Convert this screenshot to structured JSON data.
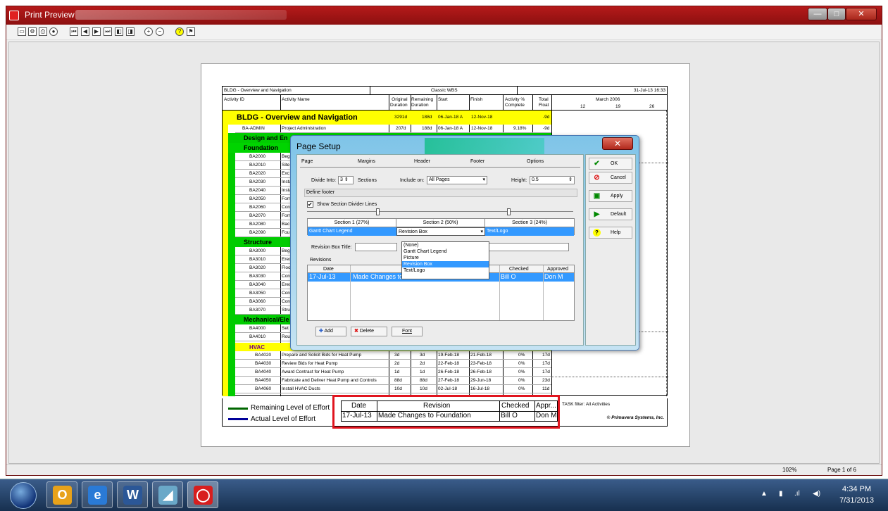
{
  "window": {
    "title": "Print Preview",
    "min": "—",
    "max": "□",
    "close": "✕"
  },
  "toolbar": {
    "icons": [
      "page-setup-icon",
      "print-options-icon",
      "print-icon",
      "publish-icon",
      "first-page-icon",
      "prev-page-icon",
      "next-page-icon",
      "last-page-icon",
      "first-icon",
      "last-icon",
      "zoom-in-icon",
      "zoom-out-icon",
      "help-icon",
      "settings-icon"
    ]
  },
  "report": {
    "header_left": "BLDG - Overview and Navigation",
    "header_center": "Classic WBS",
    "header_right": "31-Jul-13 16:33",
    "cols": {
      "id": "Activity ID",
      "name": "Activity Name",
      "orig1": "Original",
      "orig2": "Duration",
      "rem1": "Remaining",
      "rem2": "Duration",
      "start": "Start",
      "finish": "Finish",
      "pct1": "Activity %",
      "pct2": "Complete",
      "float1": "Total",
      "float2": "Float",
      "month": "March 2006",
      "w1": "12",
      "w2": "19",
      "w3": "26"
    },
    "project": {
      "name": "BLDG - Overview and Navigation",
      "orig": "3291d",
      "rem": "188d",
      "start": "06-Jan-18 A",
      "finish": "12-Nov-18",
      "float": "-9d"
    },
    "admin": {
      "id": "BA-ADMIN",
      "name": "Project Administration",
      "orig": "207d",
      "rem": "188d",
      "start": "06-Jan-18 A",
      "finish": "12-Nov-18",
      "pct": "9.18%",
      "float": "-9d"
    },
    "design": "Design and En",
    "foundation": "Foundation",
    "found_rows": [
      {
        "id": "BA2000",
        "n": "Beg"
      },
      {
        "id": "BA2010",
        "n": "Site"
      },
      {
        "id": "BA2020",
        "n": "Exc"
      },
      {
        "id": "BA2030",
        "n": "Insta"
      },
      {
        "id": "BA2040",
        "n": "Insta"
      },
      {
        "id": "BA2050",
        "n": "Forn"
      },
      {
        "id": "BA2060",
        "n": "Con"
      },
      {
        "id": "BA2070",
        "n": "Forn"
      },
      {
        "id": "BA2080",
        "n": "Bac"
      },
      {
        "id": "BA2090",
        "n": "Fou"
      }
    ],
    "structure": "Structure",
    "struct_rows": [
      {
        "id": "BA3000",
        "n": "Beg"
      },
      {
        "id": "BA3010",
        "n": "Erec"
      },
      {
        "id": "BA3020",
        "n": "Floo"
      },
      {
        "id": "BA3030",
        "n": "Con"
      },
      {
        "id": "BA3040",
        "n": "Erec"
      },
      {
        "id": "BA3050",
        "n": "Con"
      },
      {
        "id": "BA3060",
        "n": "Con"
      },
      {
        "id": "BA3070",
        "n": "Stru"
      }
    ],
    "mech": "Mechanical/Ele",
    "mech_rows": [
      {
        "id": "BA4000",
        "n": "Set"
      },
      {
        "id": "BA4010",
        "n": "Rou"
      }
    ],
    "hvac": "HVAC",
    "hvac_rows": [
      {
        "id": "BA4020",
        "n": "Prepare and Solicit Bids for Heat Pump",
        "o": "3d",
        "r": "3d",
        "s": "19-Feb-18",
        "f": "21-Feb-18",
        "p": "0%",
        "t": "17d"
      },
      {
        "id": "BA4030",
        "n": "Review Bids for Heat Pump",
        "o": "2d",
        "r": "2d",
        "s": "22-Feb-18",
        "f": "23-Feb-18",
        "p": "0%",
        "t": "17d"
      },
      {
        "id": "BA4040",
        "n": "Award Contract for Heat Pump",
        "o": "1d",
        "r": "1d",
        "s": "26-Feb-18",
        "f": "26-Feb-18",
        "p": "0%",
        "t": "17d"
      },
      {
        "id": "BA4050",
        "n": "Fabricate and Deliver Heat Pump and Controls",
        "o": "88d",
        "r": "88d",
        "s": "27-Feb-18",
        "f": "29-Jun-18",
        "p": "0%",
        "t": "23d"
      },
      {
        "id": "BA4060",
        "n": "Install HVAC Ducts",
        "o": "10d",
        "r": "10d",
        "s": "02-Jul-18",
        "f": "16-Jul-18",
        "p": "0%",
        "t": "11d"
      }
    ],
    "legend_remaining": "Remaining Level of Effort",
    "legend_actual": "Actual Level of Effort",
    "footer_filter": "TASK filter: All Activities",
    "footer_copyright": "© Primavera Systems, Inc.",
    "rev": {
      "h_date": "Date",
      "h_rev": "Revision",
      "h_checked": "Checked",
      "h_appr": "Appr...",
      "date": "17-Jul-13",
      "revision": "Made Changes to Foundation",
      "checked": "Bill O",
      "appr": "Don M"
    }
  },
  "dialog": {
    "title": "Page Setup",
    "tabs": [
      "Page",
      "Margins",
      "Header",
      "Footer",
      "Options"
    ],
    "divide_label": "Divide Into:",
    "divide_value": "3",
    "sections_label": "Sections",
    "include_label": "Include on:",
    "include_value": "All Pages",
    "height_label": "Height:",
    "height_value": "0.5",
    "define_footer": "Define footer",
    "show_lines": "Show Section Divider Lines",
    "sec1": "Section 1 (27%)",
    "sec2": "Section 2 (50%)",
    "sec3": "Section 3 (24%)",
    "sec1_val": "Gantt Chart Legend",
    "sec2_val": "Revision Box",
    "sec3_val": "Text/Logo",
    "rev_title_label": "Revision Box Title:",
    "revisions_label": "Revisions",
    "grid_h": {
      "date": "Date",
      "checked": "Checked",
      "approved": "Approved"
    },
    "grid_row": {
      "date": "17-Jul-13",
      "rev": "Made Changes to Foundation",
      "checked": "Bill O",
      "approved": "Don M"
    },
    "dropdown": [
      "(None)",
      "Gantt Chart Legend",
      "Picture",
      "Revision Box",
      "Text/Logo"
    ],
    "add": "Add",
    "delete": "Delete",
    "font": "Font",
    "ok": "OK",
    "cancel": "Cancel",
    "apply": "Apply",
    "default": "Default",
    "help": "Help"
  },
  "status": {
    "zoom": "102%",
    "page": "Page 1 of 6"
  },
  "taskbar": {
    "time": "4:34 PM",
    "date": "7/31/2013"
  }
}
